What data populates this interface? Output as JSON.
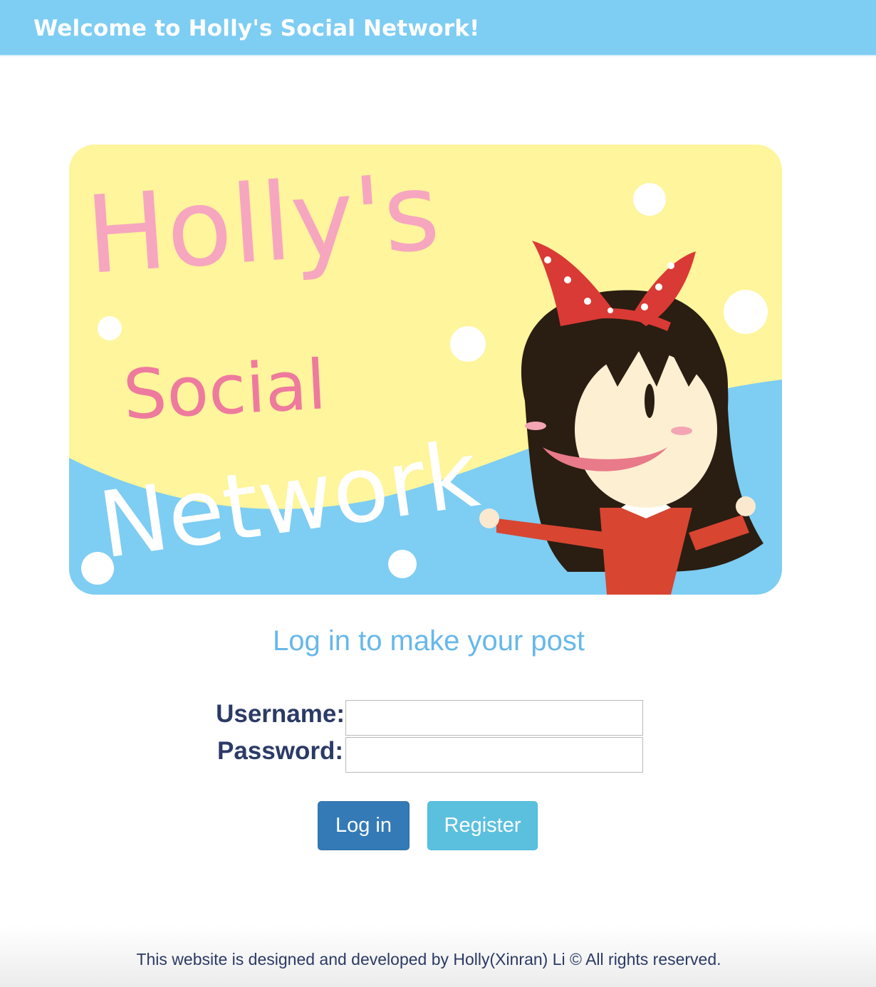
{
  "header": {
    "title": "Welcome to Holly's Social Network!"
  },
  "banner": {
    "logo_line1": "Holly's",
    "logo_line2": "Social",
    "logo_line3": "Network"
  },
  "login": {
    "heading": "Log in to make your post",
    "username_label": "Username:",
    "password_label": "Password:",
    "username_value": "",
    "password_value": "",
    "login_button": "Log in",
    "register_button": "Register"
  },
  "footer": {
    "text": "This website is designed and developed by Holly(Xinran) Li © All rights reserved."
  },
  "colors": {
    "header_bg": "#7ecdf3",
    "heading": "#67b8ea",
    "label": "#2b3a66",
    "login_button": "#337ab7",
    "register_button": "#5bc0de"
  }
}
